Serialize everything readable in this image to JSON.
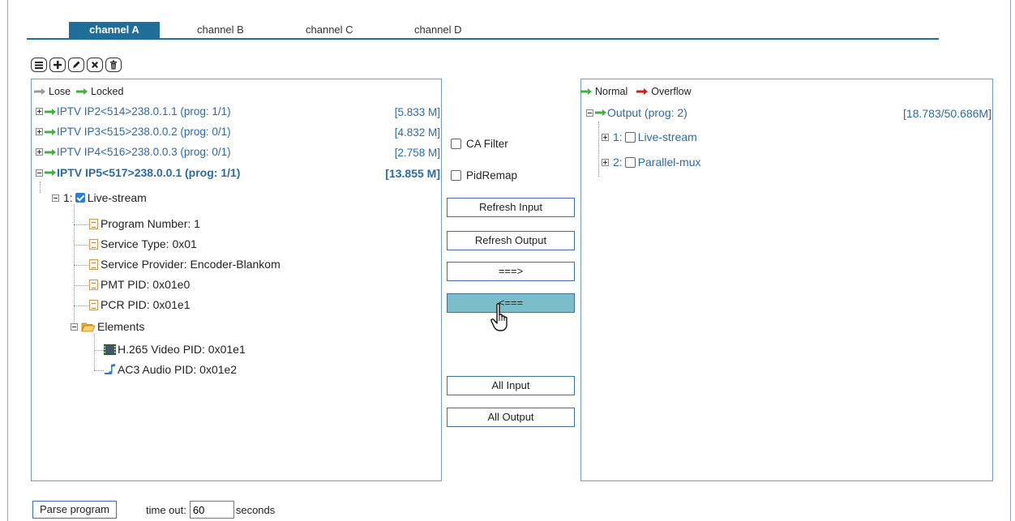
{
  "tabs": [
    "channel A",
    "channel B",
    "channel C",
    "channel D"
  ],
  "toolbar": [
    "list-icon",
    "plus-icon",
    "pencil-icon",
    "delete-icon",
    "trash-icon"
  ],
  "input_panel": {
    "legend": {
      "lose": "Lose",
      "locked": "Locked"
    },
    "sources": [
      {
        "label": "IPTV IP2<514>238.0.1.1 (prog: 1/1)",
        "rate": "[5.833 M]",
        "expanded": false
      },
      {
        "label": "IPTV IP3<515>238.0.0.2 (prog: 0/1)",
        "rate": "[4.832 M]",
        "expanded": false
      },
      {
        "label": "IPTV IP4<516>238.0.0.3 (prog: 0/1)",
        "rate": "[2.758 M]",
        "expanded": false
      },
      {
        "label": "IPTV IP5<517>238.0.0.1 (prog: 1/1)",
        "rate": "[13.855 M]",
        "expanded": true
      }
    ],
    "program": {
      "label": "1:",
      "name": "Live-stream",
      "checked": true
    },
    "details": [
      "Program Number: 1",
      "Service Type: 0x01",
      "Service Provider: Encoder-Blankom",
      "PMT PID: 0x01e0",
      "PCR PID: 0x01e1"
    ],
    "elements_label": "Elements",
    "elements": [
      {
        "label": "H.265 Video PID: 0x01e1",
        "icon": "video-icon"
      },
      {
        "label": "AC3 Audio PID: 0x01e2",
        "icon": "audio-icon"
      }
    ]
  },
  "middle": {
    "ca_filter": "CA Filter",
    "pid_remap": "PidRemap",
    "refresh_input": "Refresh Input",
    "refresh_output": "Refresh Output",
    "add": "===>",
    "remove": "<===",
    "all_input": "All Input",
    "all_output": "All Output"
  },
  "output_panel": {
    "legend": {
      "normal": "Normal",
      "overflow": "Overflow"
    },
    "output_label": "Output (prog: 2)",
    "output_rate": "[18.783/50.686M]",
    "programs": [
      {
        "num": "1:",
        "name": "Live-stream"
      },
      {
        "num": "2:",
        "name": "Parallel-mux"
      }
    ]
  },
  "bottom": {
    "parse_button": "Parse program",
    "timeout_label": "time out:",
    "timeout_value": "60",
    "seconds_label": "seconds"
  },
  "colors": {
    "accent": "#1f6e99",
    "border": "#6e9ec9",
    "arrow_green": "#3fb23f",
    "arrow_red": "#cc1f1f",
    "hover": "#79bec8"
  }
}
